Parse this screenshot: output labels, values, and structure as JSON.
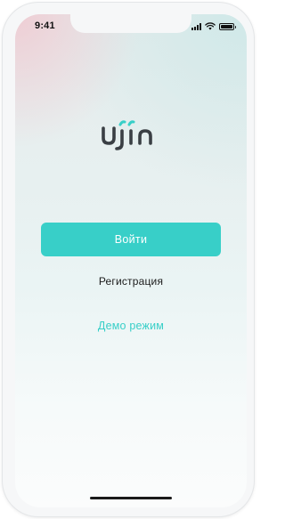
{
  "status_bar": {
    "time": "9:41",
    "icons": [
      "cellular-signal-icon",
      "wifi-icon",
      "battery-icon"
    ],
    "battery_level": 1.0
  },
  "logo": {
    "text": "ujin",
    "color": "#3a3f44",
    "accent_color": "#38cfc8"
  },
  "actions": {
    "login_label": "Войти",
    "register_label": "Регистрация",
    "demo_label": "Демо режим"
  },
  "colors": {
    "accent": "#38cfc8",
    "text_dark": "#1b1b1b"
  }
}
